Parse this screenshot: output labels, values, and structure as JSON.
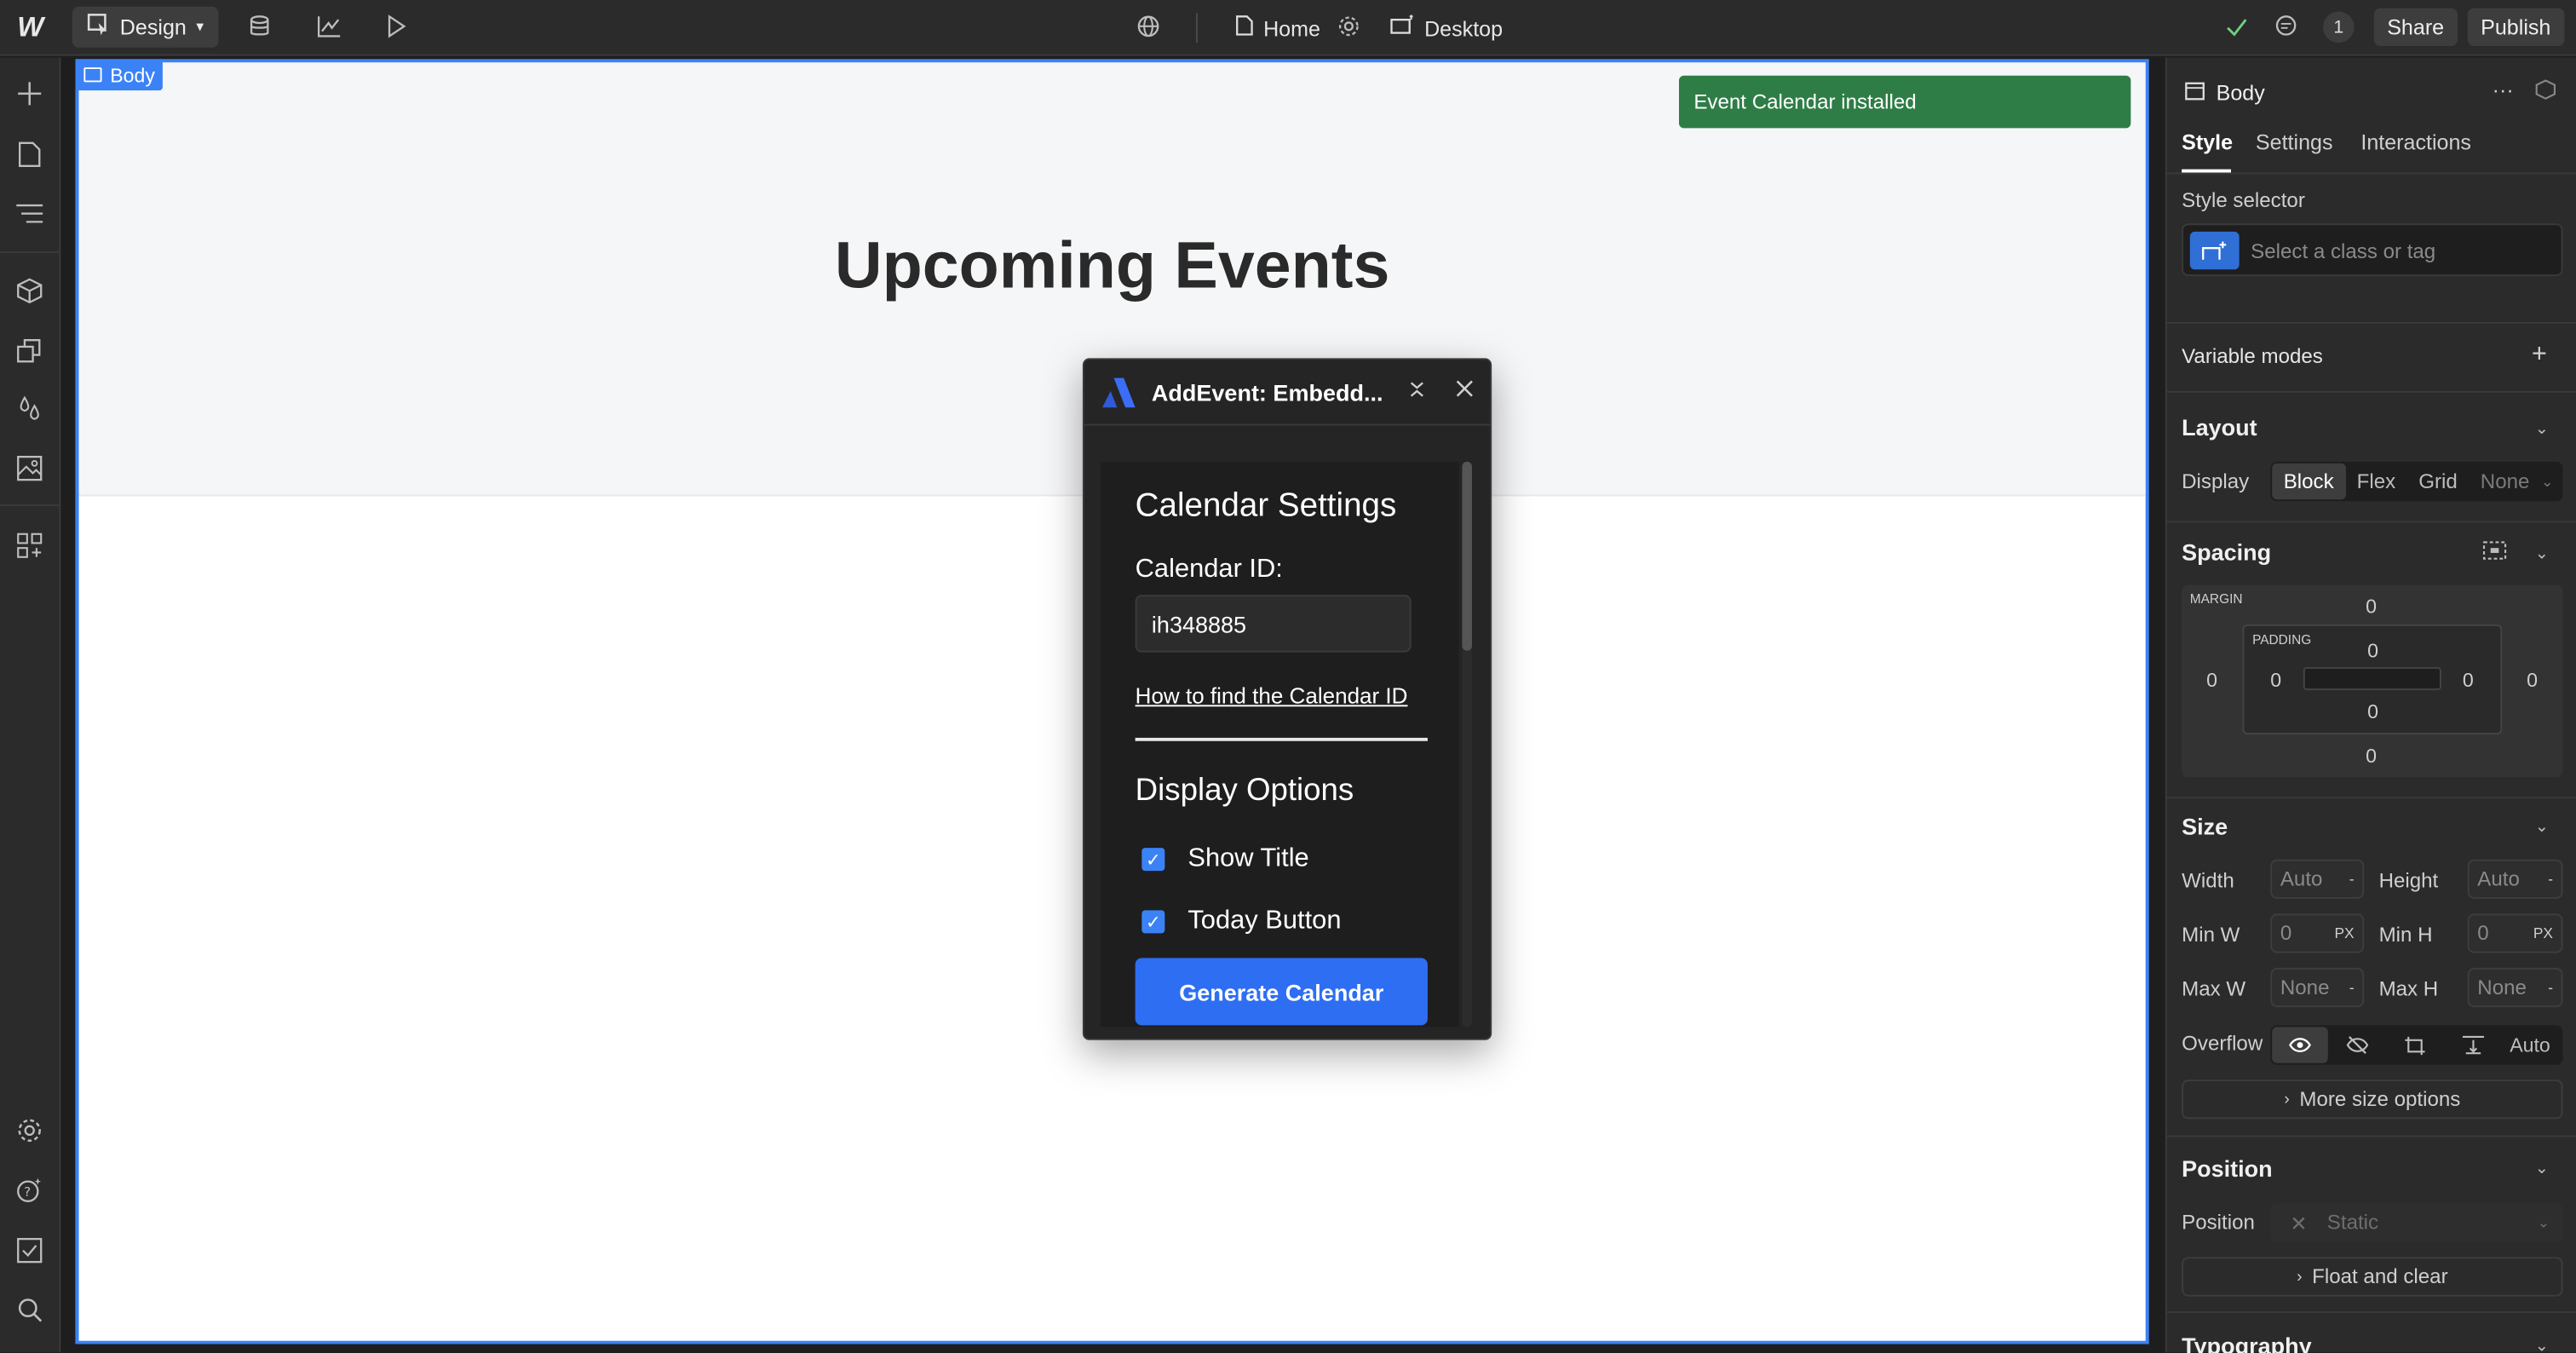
{
  "topbar": {
    "mode_label": "Design",
    "page_label": "Home",
    "breakpoint_label": "Desktop",
    "comment_count": "1",
    "share_label": "Share",
    "publish_label": "Publish"
  },
  "canvas": {
    "selected_tag": "Body",
    "hero_title": "Upcoming Events"
  },
  "toast": {
    "message": "Event Calendar installed"
  },
  "dialog": {
    "title": "AddEvent: Embedd...",
    "settings_heading": "Calendar Settings",
    "calendar_id_label": "Calendar ID:",
    "calendar_id_value": "ih348885",
    "help_link": "How to find the Calendar ID",
    "display_options_heading": "Display Options",
    "options": [
      {
        "label": "Show Title",
        "checked": true
      },
      {
        "label": "Today Button",
        "checked": true
      }
    ],
    "generate_button": "Generate Calendar",
    "accent_color": "#2d6ef3"
  },
  "panel": {
    "element_name": "Body",
    "tabs": [
      "Style",
      "Settings",
      "Interactions"
    ],
    "style_selector_label": "Style selector",
    "style_selector_placeholder": "Select a class or tag",
    "variable_modes_label": "Variable modes",
    "layout": {
      "heading": "Layout",
      "display_label": "Display",
      "options": [
        "Block",
        "Flex",
        "Grid",
        "None"
      ],
      "selected": "Block"
    },
    "spacing": {
      "heading": "Spacing",
      "margin_label": "MARGIN",
      "padding_label": "PADDING",
      "margin": {
        "top": "0",
        "right": "0",
        "bottom": "0",
        "left": "0"
      },
      "padding": {
        "top": "0",
        "right": "0",
        "bottom": "0",
        "left": "0"
      }
    },
    "size": {
      "heading": "Size",
      "width_label": "Width",
      "width_value": "Auto",
      "height_label": "Height",
      "height_value": "Auto",
      "minw_label": "Min W",
      "minw_value": "0",
      "minh_label": "Min H",
      "minh_value": "0",
      "maxw_label": "Max W",
      "maxw_value": "None",
      "maxh_label": "Max H",
      "maxh_value": "None",
      "unit_px": "PX",
      "unit_dash": "-",
      "overflow_label": "Overflow",
      "overflow_auto": "Auto",
      "more_label": "More size options"
    },
    "position": {
      "heading": "Position",
      "position_label": "Position",
      "position_value": "Static",
      "float_label": "Float and clear"
    },
    "typography_heading": "Typography"
  }
}
